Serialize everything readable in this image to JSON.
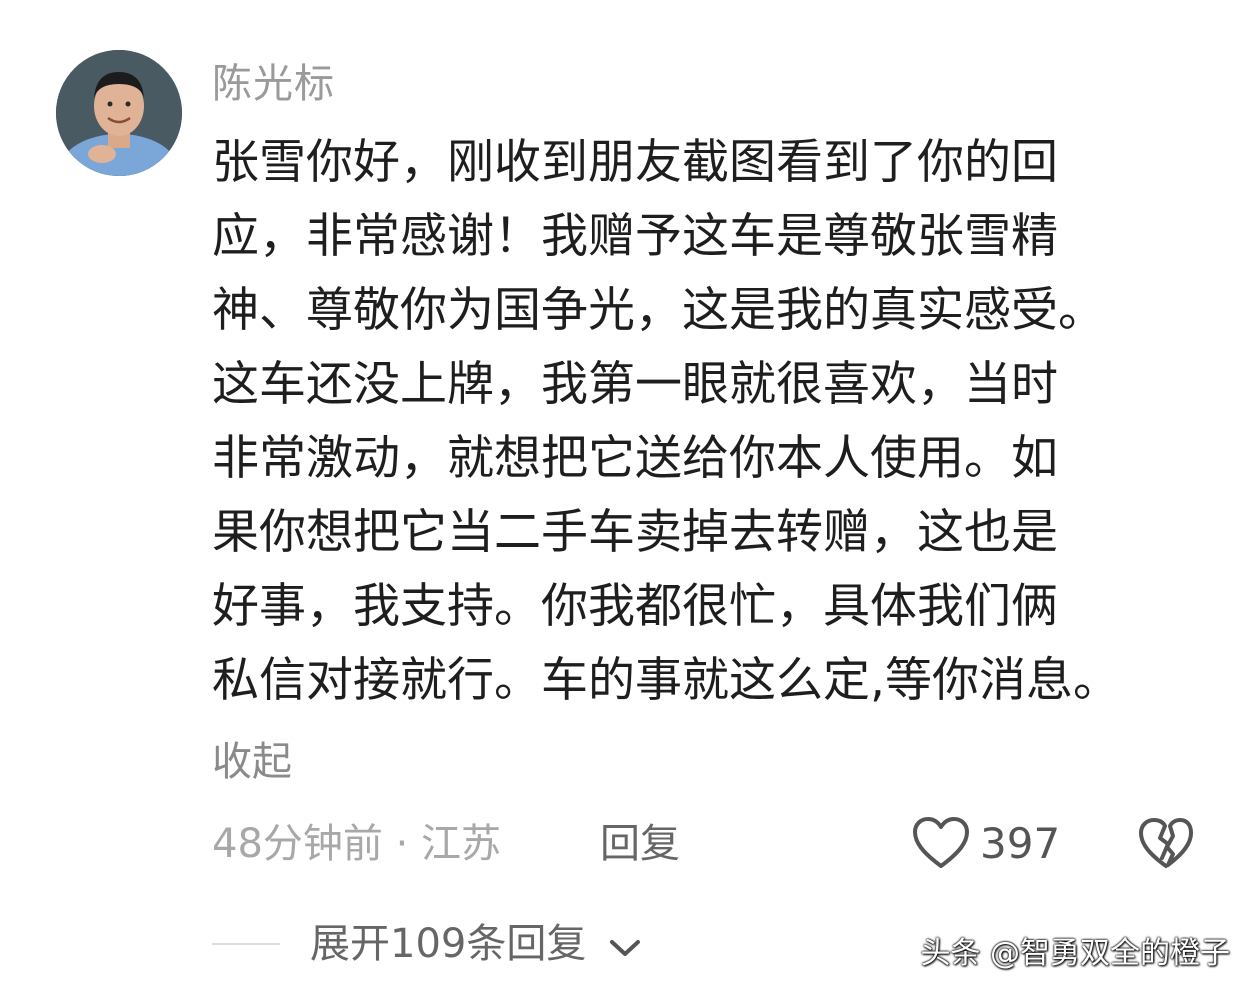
{
  "comment": {
    "username": "陈光标",
    "avatar_icon": "user-avatar-photo",
    "lines": [
      "张雪你好，刚收到朋友截图看到了你的回",
      "应，非常感谢！我赠予这车是尊敬张雪精",
      "神、尊敬你为国争光，这是我的真实感受。",
      "这车还没上牌，我第一眼就很喜欢，当时",
      "非常激动，就想把它送给你本人使用。如",
      "果你想把它当二手车卖掉去转赠，这也是",
      "好事，我支持。你我都很忙，具体我们俩",
      "私信对接就行。车的事就这么定,等你消息。"
    ],
    "collapse_label": "收起",
    "time_location": "48分钟前 · 江苏",
    "reply_label": "回复",
    "like_icon": "heart-outline-icon",
    "like_count": "397",
    "dislike_icon": "broken-heart-icon"
  },
  "replies": {
    "expand_label": "展开109条回复",
    "expand_icon": "chevron-down-icon"
  },
  "watermark": "头条 @智勇双全的橙子",
  "colors": {
    "text_primary": "#1e1e1e",
    "text_secondary": "#9a9a9a",
    "background": "#ffffff"
  }
}
